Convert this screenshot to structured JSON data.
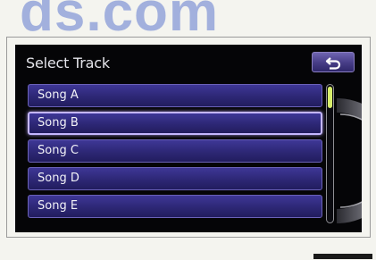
{
  "watermark": {
    "text": "ds.com"
  },
  "screen": {
    "title": "Select Track",
    "back_button": {
      "icon": "back-arrow-icon"
    },
    "tracks": [
      "Song A",
      "Song B",
      "Song C",
      "Song D",
      "Song E"
    ],
    "selected_track": "Song B",
    "scroll_position": 0.0
  },
  "colors": {
    "screen_bg": "#050507",
    "row_fill": "#2d2775",
    "row_border": "#6b62b8",
    "selected_border": "#c4b6ff",
    "scroll_thumb": "#d8ee6a"
  }
}
